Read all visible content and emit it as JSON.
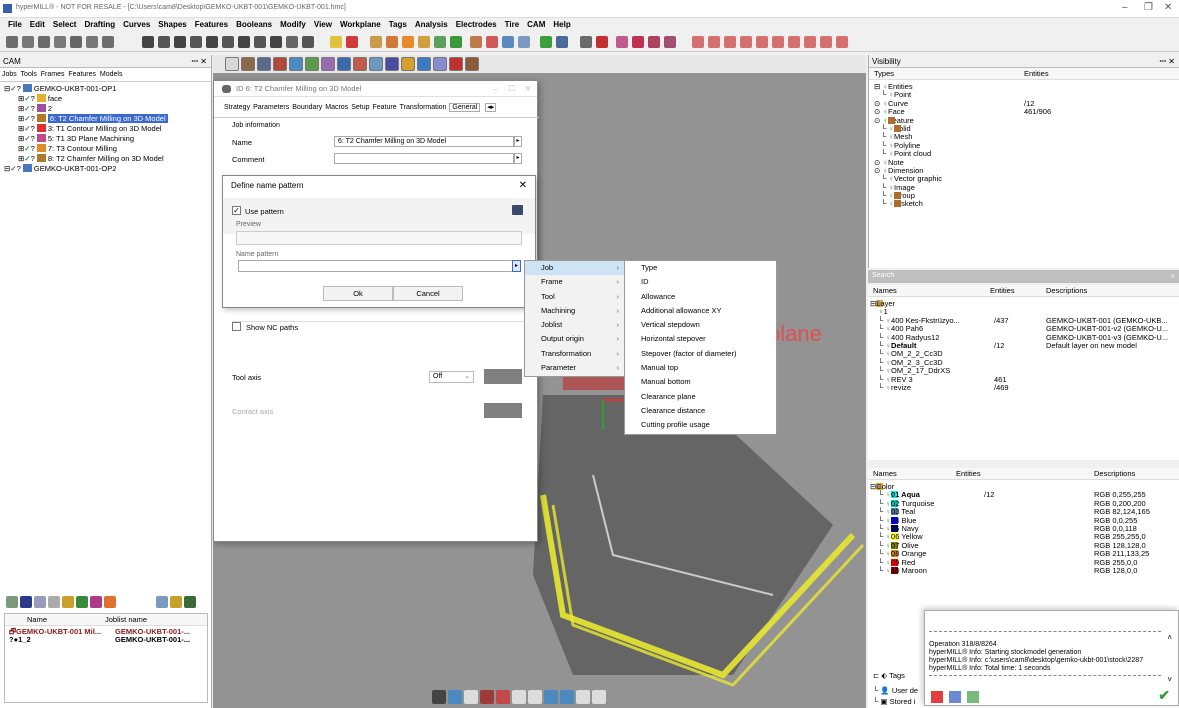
{
  "window": {
    "title": "hyperMILL® - NOT FOR RESALE - [C:\\Users\\cam8\\Desktop\\GEMKO-UKBT-001\\GEMKO-UKBT-001.hmc]"
  },
  "menu": [
    "File",
    "Edit",
    "Select",
    "Drafting",
    "Curves",
    "Shapes",
    "Features",
    "Booleans",
    "Modify",
    "View",
    "Workplane",
    "Tags",
    "Analysis",
    "Electrodes",
    "Tire",
    "CAM",
    "Help"
  ],
  "cam": {
    "title": "CAM",
    "tabs": "Jobs  Tools  Frames  Features  Models",
    "tree": [
      "GEMKO-UKBT-001-OP1",
      "face",
      "2",
      "6: T2 Chamfer Milling on 3D Model",
      "3: T1 Contour Milling on 3D Model",
      "5: T1 3D Plane Machining",
      "7: T3 Contour Milling",
      "8: T2 Chamfer Milling on 3D Model",
      "GEMKO-UKBT-001-OP2"
    ],
    "joblist_headers": [
      "Name",
      "Joblist name"
    ],
    "joblist": [
      [
        "GEMKO-UKBT-001 Mil...",
        "GEMKO-UKBT-001-..."
      ],
      [
        "1_2",
        "GEMKO-UKBT-001-..."
      ]
    ]
  },
  "dialog": {
    "title": "ID 6: T2 Chamfer Milling on 3D Model",
    "tabs": [
      "Strategy",
      "Parameters",
      "Boundary",
      "Macros",
      "Setup",
      "Feature",
      "Transformation",
      "General"
    ],
    "section": "Job information",
    "name_label": "Name",
    "name_value": "6: T2 Chamfer Milling on 3D Model",
    "comment_label": "Comment",
    "show_nc": "Show NC paths",
    "tool_axis_label": "Tool axis",
    "tool_axis_value": "Off",
    "contact_axis_label": "Contact axis"
  },
  "pattern": {
    "title": "Define name pattern",
    "use_pattern": "Use pattern",
    "preview": "Preview",
    "name_pattern": "Name pattern",
    "ok": "Ok",
    "cancel": "Cancel"
  },
  "ctx1": [
    "Job",
    "Frame",
    "Tool",
    "Machining",
    "Joblist",
    "Output origin",
    "Transformation",
    "Parameter"
  ],
  "ctx2": [
    "Type",
    "ID",
    "Allowance",
    "Additional allowance XY",
    "Vertical stepdown",
    "Horizontal stepover",
    "Stepover (factor of diameter)",
    "Manual top",
    "Manual bottom",
    "Clearance plane",
    "Clearance distance",
    "Cutting profile usage"
  ],
  "viewport": {
    "watermark": "plane"
  },
  "visibility": {
    "title": "Visibility",
    "headers": [
      "Types",
      "Entities"
    ],
    "rows": [
      [
        "Entities",
        ""
      ],
      [
        "Point",
        ""
      ],
      [
        "Curve",
        "/12"
      ],
      [
        "Face",
        "461/906"
      ],
      [
        "Feature",
        ""
      ],
      [
        "Solid",
        ""
      ],
      [
        "Mesh",
        ""
      ],
      [
        "Polyline",
        ""
      ],
      [
        "Point cloud",
        ""
      ],
      [
        "Note",
        ""
      ],
      [
        "Dimension",
        ""
      ],
      [
        "Vector graphic",
        ""
      ],
      [
        "Image",
        ""
      ],
      [
        "Group",
        ""
      ],
      [
        "V sketch",
        ""
      ]
    ]
  },
  "search": {
    "label": "Search"
  },
  "layers": {
    "headers": [
      "Names",
      "Entities",
      "Descriptions"
    ],
    "rows": [
      [
        "Layer",
        "",
        ""
      ],
      [
        "1",
        "",
        ""
      ],
      [
        "400 Kes-Fkstrüzyo...",
        "/437",
        "GEMKO-UKBT-001 (GEMKO-UKB..."
      ],
      [
        "400 Pah6",
        "",
        "GEMKO-UKBT-001-v2 (GEMKO-U..."
      ],
      [
        "400 Radyus12",
        "",
        "GEMKO-UKBT-001-v3 (GEMKO-U..."
      ],
      [
        "Default",
        "/12",
        "Default layer on new model"
      ],
      [
        "OM_2_2_Cc3D",
        "",
        ""
      ],
      [
        "OM_2_3_Cc3D",
        "",
        ""
      ],
      [
        "OM_2_17_DdrXS",
        "",
        ""
      ],
      [
        "REV 3",
        "461",
        ""
      ],
      [
        "revize",
        "/469",
        ""
      ]
    ]
  },
  "colors": {
    "headers": [
      "Names",
      "Entities",
      "Descriptions"
    ],
    "rows": [
      [
        "Color",
        "",
        "",
        "#ffffff"
      ],
      [
        "01 Aqua",
        "/12",
        "RGB 0,255,255",
        "#00ffff"
      ],
      [
        "02 Turquoise",
        "",
        "RGB 0,200,200",
        "#00c8c8"
      ],
      [
        "03 Teal",
        "",
        "RGB 82,124,165",
        "#527ca5"
      ],
      [
        "04 Blue",
        "",
        "RGB 0,0,255",
        "#0000ff"
      ],
      [
        "05 Navy",
        "",
        "RGB 0,0,118",
        "#000076"
      ],
      [
        "06 Yellow",
        "",
        "RGB 255,255,0",
        "#ffff00"
      ],
      [
        "07 Olive",
        "",
        "RGB 128,128,0",
        "#808000"
      ],
      [
        "08 Orange",
        "",
        "RGB 211,133,25",
        "#d38519"
      ],
      [
        "09 Red",
        "",
        "RGB 255,0,0",
        "#ff0000"
      ],
      [
        "10 Maroon",
        "",
        "RGB 128,0,0",
        "#800000"
      ]
    ],
    "tags": "Tags",
    "user": "User de",
    "stored": "Stored i"
  },
  "log": {
    "lines": [
      "Operation 318/8/8264",
      "hyperMILL® Info:   Starting stockmodel generation",
      "hyperMILL® Info:   c:\\users\\cam8\\desktop\\gemko-ukbt-001\\stock\\2287",
      "hyperMILL® Info:   Total time: 1 seconds"
    ]
  }
}
